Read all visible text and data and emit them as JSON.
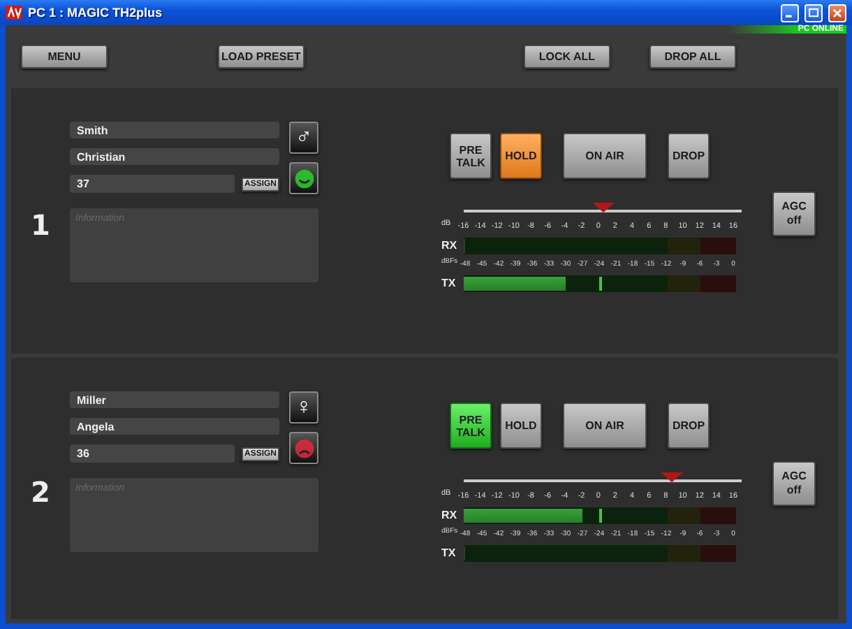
{
  "window": {
    "title": "PC 1 : MAGIC TH2plus"
  },
  "status_badge": "PC ONLINE",
  "toolbar": {
    "left": [
      {
        "label": "MENU"
      },
      {
        "label": "LOAD PRESET"
      }
    ],
    "right": [
      {
        "label": "LOCK ALL"
      },
      {
        "label": "DROP ALL"
      }
    ]
  },
  "lines": [
    {
      "number": "1",
      "last_name": "Smith",
      "first_name": "Christian",
      "id": "37",
      "assign_label": "ASSIGN",
      "info_placeholder": "Information",
      "gender_symbol": "♂",
      "kind": "ok",
      "call_buttons": [
        {
          "label": "PRE TALK",
          "kind": "pretalk",
          "on": false
        },
        {
          "label": "HOLD",
          "kind": "hold",
          "on": true
        },
        {
          "label": "ON AIR",
          "kind": "onair",
          "on": false
        },
        {
          "label": "DROP",
          "kind": "drop",
          "on": false
        }
      ],
      "gain": {
        "unit": "dB",
        "level": 0.5,
        "ticks": [
          "-16",
          "-14",
          "-12",
          "-10",
          "-8",
          "-6",
          "-4",
          "-2",
          "0",
          "2",
          "4",
          "6",
          "8",
          "10",
          "12",
          "14",
          "16"
        ]
      },
      "meters": {
        "unit": "dBFs",
        "ticks": [
          "-48",
          "-45",
          "-42",
          "-39",
          "-36",
          "-33",
          "-30",
          "-27",
          "-24",
          "-21",
          "-18",
          "-15",
          "-12",
          "-9",
          "-6",
          "-3",
          "0"
        ],
        "rx": {
          "label": "RX",
          "level": 0
        },
        "tx": {
          "label": "TX",
          "level": 0.375,
          "peak": {
            "level": 0.5
          }
        }
      },
      "agc": "AGC off"
    },
    {
      "number": "2",
      "last_name": "Miller",
      "first_name": "Angela",
      "id": "36",
      "assign_label": "ASSIGN",
      "info_placeholder": "Information",
      "gender_symbol": "♀",
      "kind": "error",
      "call_buttons": [
        {
          "label": "PRE TALK",
          "kind": "pretalk",
          "on": true
        },
        {
          "label": "HOLD",
          "kind": "hold",
          "on": false
        },
        {
          "label": "ON AIR",
          "kind": "onair",
          "on": false
        },
        {
          "label": "DROP",
          "kind": "drop",
          "on": false
        }
      ],
      "gain": {
        "unit": "dB",
        "level": 0.75,
        "ticks": [
          "-16",
          "-14",
          "-12",
          "-10",
          "-8",
          "-6",
          "-4",
          "-2",
          "0",
          "2",
          "4",
          "6",
          "8",
          "10",
          "12",
          "14",
          "16"
        ]
      },
      "meters": {
        "unit": "dBFs",
        "ticks": [
          "-48",
          "-45",
          "-42",
          "-39",
          "-36",
          "-33",
          "-30",
          "-27",
          "-24",
          "-21",
          "-18",
          "-15",
          "-12",
          "-9",
          "-6",
          "-3",
          "0"
        ],
        "rx": {
          "label": "RX",
          "level": 0.4375,
          "peak": {
            "level": 0.5
          }
        },
        "tx": {
          "label": "TX",
          "level": 0
        }
      },
      "agc": "AGC off"
    }
  ]
}
